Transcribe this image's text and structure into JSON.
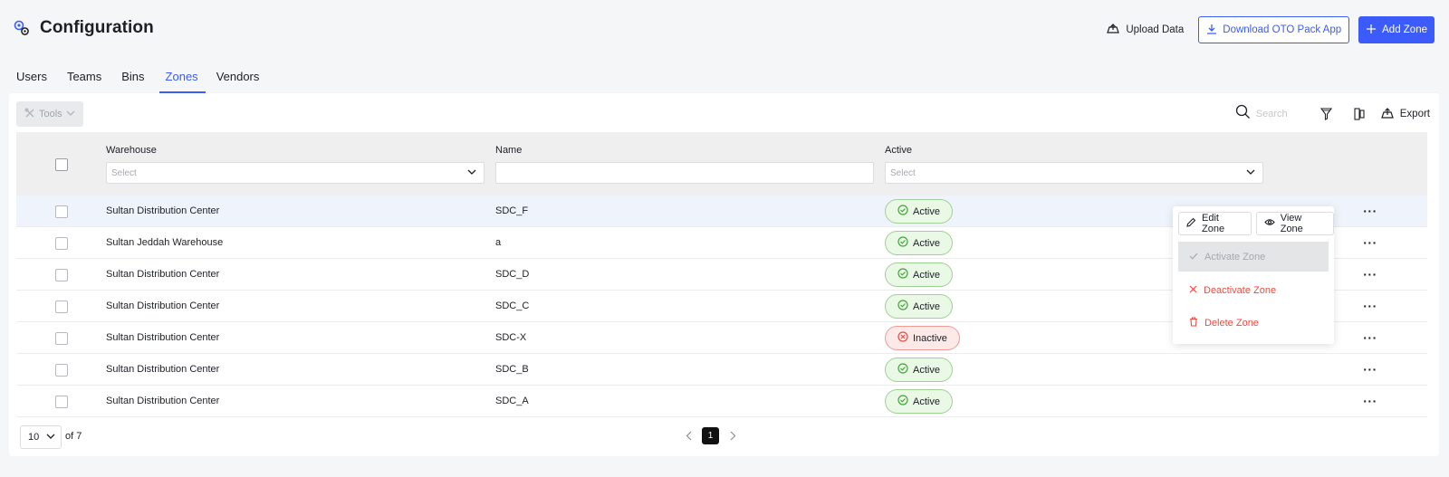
{
  "header": {
    "title": "Configuration",
    "upload_label": "Upload Data",
    "download_label": "Download OTO Pack App",
    "add_label": "Add Zone"
  },
  "tabs": [
    {
      "label": "Users"
    },
    {
      "label": "Teams"
    },
    {
      "label": "Bins"
    },
    {
      "label": "Zones",
      "active": true
    },
    {
      "label": "Vendors"
    }
  ],
  "toolbar": {
    "tools_label": "Tools",
    "search_placeholder": "Search",
    "export_label": "Export"
  },
  "table": {
    "columns": {
      "warehouse": "Warehouse",
      "name": "Name",
      "active": "Active"
    },
    "filters": {
      "warehouse_placeholder": "Select",
      "active_placeholder": "Select"
    },
    "rows": [
      {
        "warehouse": "Sultan Distribution Center",
        "name": "SDC_F",
        "status": "Active"
      },
      {
        "warehouse": "Sultan Jeddah Warehouse",
        "name": "a",
        "status": "Active"
      },
      {
        "warehouse": "Sultan Distribution Center",
        "name": "SDC_D",
        "status": "Active"
      },
      {
        "warehouse": "Sultan Distribution Center",
        "name": "SDC_C",
        "status": "Active"
      },
      {
        "warehouse": "Sultan Distribution Center",
        "name": "SDC-X",
        "status": "Inactive"
      },
      {
        "warehouse": "Sultan Distribution Center",
        "name": "SDC_B",
        "status": "Active"
      },
      {
        "warehouse": "Sultan Distribution Center",
        "name": "SDC_A",
        "status": "Active"
      }
    ]
  },
  "footer": {
    "page_size": "10",
    "of_label": "of 7",
    "current_page": "1"
  },
  "context_menu": {
    "edit_label": "Edit Zone",
    "view_label": "View Zone",
    "activate_label": "Activate Zone",
    "deactivate_label": "Deactivate Zone",
    "delete_label": "Delete Zone"
  },
  "colors": {
    "accent": "#3b5bfd",
    "active_bg": "#eaf8e6",
    "active_border": "#9ed193",
    "active_icon": "#43a63a",
    "inactive_bg": "#fde9e8",
    "inactive_border": "#f29a94",
    "inactive_icon": "#ef4a3f",
    "danger": "#ef4a3f"
  }
}
